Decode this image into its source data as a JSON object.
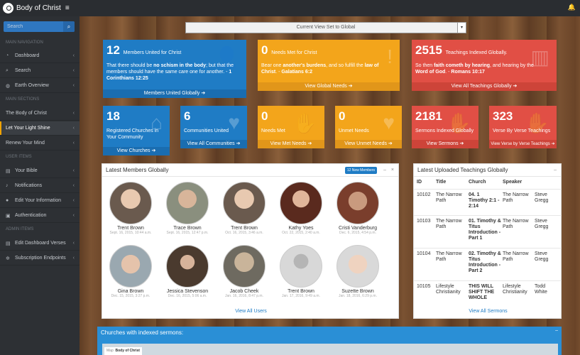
{
  "brand": {
    "title": "Body of Christ"
  },
  "sidebar": {
    "search_placeholder": "Search",
    "sections": {
      "main_navigation": "MAIN NAVIGATION",
      "main_sections": "MAIN SECTIONS",
      "user_items": "USER ITEMS",
      "admin_items": "ADMIN ITEMS"
    },
    "main_nav": [
      {
        "label": "Dashboard",
        "icon": "dashboard-icon"
      },
      {
        "label": "Search",
        "icon": "search-icon"
      },
      {
        "label": "Earth Overview",
        "icon": "globe-icon"
      }
    ],
    "main_sections": [
      {
        "label": "The Body of Christ"
      },
      {
        "label": "Let Your Light Shine"
      },
      {
        "label": "Renew Your Mind"
      }
    ],
    "user_items": [
      {
        "label": "Your Bible",
        "icon": "book-icon"
      },
      {
        "label": "Notifications",
        "icon": "bell-icon"
      },
      {
        "label": "Edit Your Information",
        "icon": "user-icon"
      },
      {
        "label": "Authentication",
        "icon": "lock-icon"
      }
    ],
    "admin_items": [
      {
        "label": "Edit Dashboard Verses",
        "icon": "book-icon"
      },
      {
        "label": "Subscription Endpoints",
        "icon": "gear-icon"
      }
    ]
  },
  "viewset": {
    "label": "Current View Set to Global"
  },
  "tiles_big": [
    {
      "count": "12",
      "label": "Members United for Christ",
      "text_a": "That there should be ",
      "bold_a": "no schism in the body",
      "text_b": "; but that the members should have the same care one for another. - ",
      "bold_b": "1 Corinthians 12:25",
      "footer": "Members United Globally"
    },
    {
      "count": "0",
      "label": "Needs Met for Christ",
      "text_a": "Bear one ",
      "bold_a": "another's burdens",
      "text_b": ", and so fulfill the ",
      "bold_b": "law of Christ",
      "text_c": ". - ",
      "bold_c": "Galatians 6:2",
      "footer": "View Global Needs"
    },
    {
      "count": "2515",
      "label": "Teachings Indexed Globally.",
      "text_a": "So then ",
      "bold_a": "faith cometh by hearing",
      "text_b": ", and hearing by the ",
      "bold_b": "Word of God",
      "text_c": ". - ",
      "bold_c": "Romans 10:17",
      "footer": "View All Teachings Globally"
    }
  ],
  "tiles_small": [
    {
      "count": "18",
      "label": "Registered Churches in Your Community",
      "footer": "View Churches"
    },
    {
      "count": "6",
      "label": "Communities United",
      "footer": "View All Communities"
    },
    {
      "count": "0",
      "label": "Needs Met",
      "footer": "View Met Needs"
    },
    {
      "count": "0",
      "label": "Unmet Needs",
      "footer": "View Unmet Needs"
    },
    {
      "count": "2181",
      "label": "Sermons Indexed Globally",
      "footer": "View Sermons"
    },
    {
      "count": "323",
      "label": "Verse By Verse Teachings",
      "footer": "View Verse by Verse Teachings"
    }
  ],
  "members": {
    "title": "Latest Members Globally",
    "badge": "12 New Members",
    "view_all": "View All Users",
    "list": [
      {
        "name": "Trent Brown",
        "date": "Sept. 16, 2015, 10:44 a.m."
      },
      {
        "name": "Trace Brown",
        "date": "Sept. 16, 2015, 12:47 p.m."
      },
      {
        "name": "Trent Brown",
        "date": "Oct. 16, 2015, 3:46 a.m."
      },
      {
        "name": "Kathy Yoes",
        "date": "Oct. 22, 2015, 2:40 a.m."
      },
      {
        "name": "Cristi Vanderburg",
        "date": "Dec. 6, 2015, 4:54 p.m."
      },
      {
        "name": "Gina Brown",
        "date": "Dec. 15, 2015, 3:27 p.m."
      },
      {
        "name": "Jessica Stevenson",
        "date": "Dec. 16, 2015, 5:06 a.m."
      },
      {
        "name": "Jacob Cheek",
        "date": "Jan. 16, 2016, 8:47 p.m."
      },
      {
        "name": "Trent Brown",
        "date": "Jan. 17, 2016, 9:49 a.m."
      },
      {
        "name": "Suzette Brown",
        "date": "Jan. 18, 2016, 6:29 p.m."
      }
    ]
  },
  "teachings": {
    "title": "Latest Uploaded Teachings Globally",
    "headers": {
      "id": "ID",
      "title": "Title",
      "church": "Church",
      "speaker": "Speaker"
    },
    "rows": [
      {
        "id": "10102",
        "title": "The Narrow Path",
        "church": "04. 1 Timothy 2:1 - 2:14",
        "speaker": "The Narrow Path",
        "speaker2": "Steve Gregg"
      },
      {
        "id": "10103",
        "title": "The Narrow Path",
        "church": "01. Timothy & Titus Introduction - Part 1",
        "speaker": "The Narrow Path",
        "speaker2": "Steve Gregg"
      },
      {
        "id": "10104",
        "title": "The Narrow Path",
        "church": "02. Timothy & Titus Introduction - Part 2",
        "speaker": "The Narrow Path",
        "speaker2": "Steve Gregg"
      },
      {
        "id": "10105",
        "title": "Lifestyle Christianity",
        "church": "THIS WILL SHIFT THE WHOLE",
        "speaker": "Lifestyle Christianity",
        "speaker2": "Todd White"
      }
    ],
    "view_all": "View All Sermons"
  },
  "map": {
    "title": "Churches with indexed sermons:",
    "tab_map": "Map",
    "tab_label": "Body of Christ"
  }
}
